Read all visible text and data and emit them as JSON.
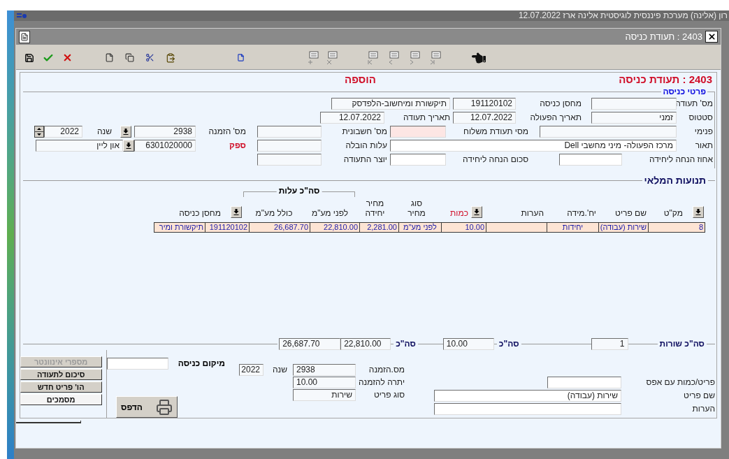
{
  "app": {
    "title": "רון (אלינה) מערכת פיננסית לוגיסטית אלינה ארז 12.07.2022"
  },
  "window": {
    "title": "2403 : תעודת כניסה"
  },
  "header": {
    "title": "2403 : תעודת כניסה",
    "mode": "הוספה"
  },
  "details": {
    "legend": "פרטי כניסה",
    "doc_number": {
      "label": "מס' תעודה"
    },
    "warehouse": {
      "label": "מחסן כניסה",
      "value": "191120102",
      "name": "תיקשורת ומיחשוב-הלפדסק"
    },
    "status": {
      "label": "סטטוס",
      "value": "זמני"
    },
    "action_date": {
      "label": "תאריך הפעולה",
      "value": "12.07.2022"
    },
    "doc_date": {
      "label": "תאריך תעודה",
      "value": "12.07.2022"
    },
    "internal": {
      "label": "פנימי"
    },
    "delivery_note": {
      "label": "מסי תעודת משלוח",
      "required": true
    },
    "invoice": {
      "label": "מס' חשבונית"
    },
    "order": {
      "label": "מס' הזמנה",
      "value": "2938"
    },
    "year": {
      "label": "שנה",
      "value": "2022"
    },
    "description": {
      "label": "תאור",
      "value": "מרכז הפעולה- מיני מחשבי Dell"
    },
    "shipping_cost": {
      "label": "עלות הובלה"
    },
    "supplier": {
      "label": "ספק",
      "value": "6301020000",
      "name": "און ליין"
    },
    "discount_percent": {
      "label": "אחוז הנחה ליחידה"
    },
    "discount_amount": {
      "label": "סכום הנחה ליחידה"
    },
    "creator": {
      "label": "יוצר התעודה"
    }
  },
  "movements": {
    "title": "תנועות המלאי",
    "cost_group": "סה\"כ עלות",
    "columns": [
      {
        "label": "מק\"ט",
        "dropdown": true,
        "highlighted": false
      },
      {
        "label": "שם פריט",
        "dropdown": false,
        "highlighted": false
      },
      {
        "label": "יח'.מידה",
        "dropdown": false,
        "highlighted": false
      },
      {
        "label": "הערות",
        "dropdown": false,
        "highlighted": false
      },
      {
        "label": "כמות",
        "dropdown": true,
        "highlighted": true
      },
      {
        "label": "סוג מחיר",
        "dropdown": false,
        "highlighted": false
      },
      {
        "label": "מחיר יחידה",
        "dropdown": false,
        "highlighted": false
      },
      {
        "label": "לפני מע\"מ",
        "dropdown": false,
        "highlighted": false
      },
      {
        "label": "כולל מע\"מ",
        "dropdown": false,
        "highlighted": false
      },
      {
        "label": "מחסן כניסה",
        "dropdown": true,
        "highlighted": false
      }
    ],
    "rows": [
      {
        "cells": [
          "8",
          "שירות (עבודה)",
          "יחידות",
          "",
          "10.00",
          "לפני מע\"מ",
          "2,281.00",
          "22,810.00",
          "26,687.70",
          "191120102",
          "תיקשורת ומיר"
        ]
      }
    ]
  },
  "totals": {
    "rows_label": "סה\"כ שורות",
    "rows_count": "1",
    "qty_label": "סה\"כ",
    "qty": "10.00",
    "cost_label": "סה\"כ",
    "before_vat": "22,810.00",
    "with_vat": "26,687.70"
  },
  "item": {
    "zero_qty": {
      "label": "פריט/כמות עם אפס"
    },
    "item_name": {
      "label": "שם פריט",
      "value": "שירות (עבודה)"
    },
    "notes": {
      "label": "הערות"
    },
    "order": {
      "label": "מס.הזמנה",
      "value": "2938"
    },
    "year": {
      "label": "שנה",
      "value": "2022"
    },
    "balance": {
      "label": "יתרה להזמנה",
      "value": "10.00"
    },
    "item_type": {
      "label": "סוג פריט",
      "value": "שירות"
    },
    "location": {
      "label": "מיקום כניסה"
    },
    "print": "הדפס"
  },
  "actions": [
    {
      "label": "מספרי אינוונטר",
      "disabled": true
    },
    {
      "label": "סיכום לתעודה",
      "disabled": false
    },
    {
      "label": "הו' פריט חדש",
      "disabled": false
    },
    {
      "label": "מסמכים",
      "disabled": false
    }
  ]
}
